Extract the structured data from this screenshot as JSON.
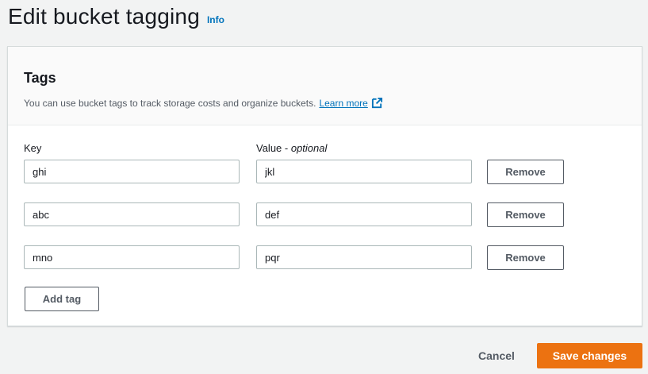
{
  "page": {
    "title": "Edit bucket tagging",
    "info_label": "Info"
  },
  "panel": {
    "title": "Tags",
    "description": "You can use bucket tags to track storage costs and organize buckets.",
    "learn_more": "Learn more",
    "key_label": "Key",
    "value_label": "Value - ",
    "value_optional": "optional"
  },
  "tags": [
    {
      "key": "ghi",
      "value": "jkl",
      "remove_label": "Remove"
    },
    {
      "key": "abc",
      "value": "def",
      "remove_label": "Remove"
    },
    {
      "key": "mno",
      "value": "pqr",
      "remove_label": "Remove"
    }
  ],
  "actions": {
    "add_tag": "Add tag",
    "cancel": "Cancel",
    "save": "Save changes"
  },
  "icons": {
    "external_link": "external-link-icon"
  },
  "colors": {
    "primary_button": "#ec7211",
    "link": "#0073bb",
    "background": "#f2f3f3"
  }
}
